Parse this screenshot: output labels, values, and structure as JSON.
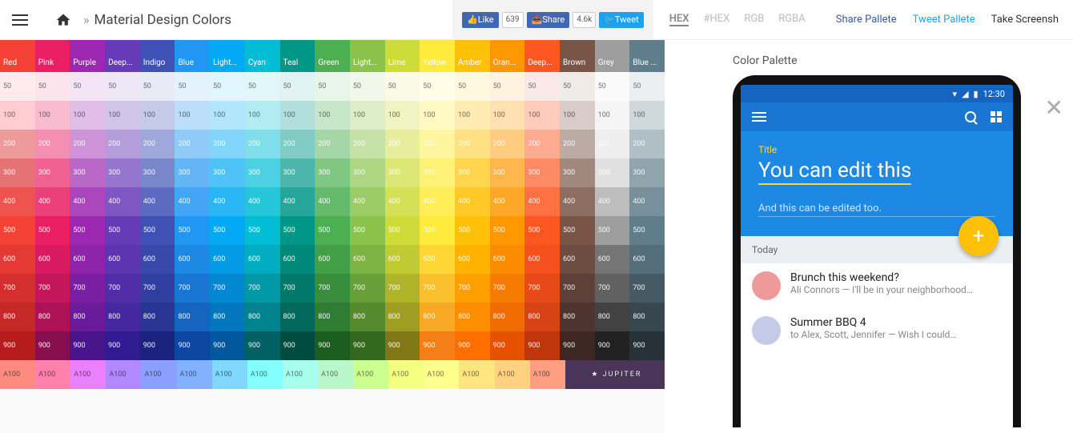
{
  "header": {
    "title": "Material Design Colors",
    "sep": "»"
  },
  "social": {
    "like": "Like",
    "like_cnt": "639",
    "share": "Share",
    "share_cnt": "4.6k",
    "tweet": "Tweet"
  },
  "formats": [
    "HEX",
    "#HEX",
    "RGB",
    "RGBA"
  ],
  "actions": {
    "share": "Share Pallete",
    "tweet": "Tweet Pallete",
    "screenshot": "Take Screensh"
  },
  "side": {
    "title": "Color Palette"
  },
  "phone": {
    "time": "12:30",
    "hero_label": "Title",
    "hero_title": "You can edit this",
    "hero_sub": "And this can be edited too.",
    "section": "Today",
    "items": [
      {
        "title": "Brunch this weekend?",
        "sub": "Ali Connors — I'll be in your neighborhood…"
      },
      {
        "title": "Summer BBQ  4",
        "sub": "to Alex, Scott, Jennifer — Wish I could…"
      }
    ]
  },
  "colors": {
    "names": [
      "Red",
      "Pink",
      "Purple",
      "Deep...",
      "Indigo",
      "Blue",
      "Light...",
      "Cyan",
      "Teal",
      "Green",
      "Light...",
      "Lime",
      "Yellow",
      "Amber",
      "Oran...",
      "Deep...",
      "Brown",
      "Grey",
      "Blue ..."
    ],
    "shades": [
      "50",
      "100",
      "200",
      "300",
      "400",
      "500",
      "600",
      "700",
      "800",
      "900",
      "A100"
    ],
    "hdr": [
      "#F44336",
      "#E91E63",
      "#9C27B0",
      "#673AB7",
      "#3F51B5",
      "#2196F3",
      "#03A9F4",
      "#00BCD4",
      "#009688",
      "#4CAF50",
      "#8BC34A",
      "#CDDC39",
      "#FFEB3B",
      "#FFC107",
      "#FF9800",
      "#FF5722",
      "#795548",
      "#9E9E9E",
      "#607D8B"
    ],
    "rows": [
      [
        "#FFEBEE",
        "#FCE4EC",
        "#F3E5F5",
        "#EDE7F6",
        "#E8EAF6",
        "#E3F2FD",
        "#E1F5FE",
        "#E0F7FA",
        "#E0F2F1",
        "#E8F5E9",
        "#F1F8E9",
        "#F9FBE7",
        "#FFFDE7",
        "#FFF8E1",
        "#FFF3E0",
        "#FBE9E7",
        "#EFEBE9",
        "#FAFAFA",
        "#ECEFF1"
      ],
      [
        "#FFCDD2",
        "#F8BBD0",
        "#E1BEE7",
        "#D1C4E9",
        "#C5CAE9",
        "#BBDEFB",
        "#B3E5FC",
        "#B2EBF2",
        "#B2DFDB",
        "#C8E6C9",
        "#DCEDC8",
        "#F0F4C3",
        "#FFF9C4",
        "#FFECB3",
        "#FFE0B2",
        "#FFCCBC",
        "#D7CCC8",
        "#F5F5F5",
        "#CFD8DC"
      ],
      [
        "#EF9A9A",
        "#F48FB1",
        "#CE93D8",
        "#B39DDB",
        "#9FA8DA",
        "#90CAF9",
        "#81D4FA",
        "#80DEEA",
        "#80CBC4",
        "#A5D6A7",
        "#C5E1A5",
        "#E6EE9C",
        "#FFF59D",
        "#FFE082",
        "#FFCC80",
        "#FFAB91",
        "#BCAAA4",
        "#EEEEEE",
        "#B0BEC5"
      ],
      [
        "#E57373",
        "#F06292",
        "#BA68C8",
        "#9575CD",
        "#7986CB",
        "#64B5F6",
        "#4FC3F7",
        "#4DD0E1",
        "#4DB6AC",
        "#81C784",
        "#AED581",
        "#DCE775",
        "#FFF176",
        "#FFD54F",
        "#FFB74D",
        "#FF8A65",
        "#A1887F",
        "#E0E0E0",
        "#90A4AE"
      ],
      [
        "#EF5350",
        "#EC407A",
        "#AB47BC",
        "#7E57C2",
        "#5C6BC0",
        "#42A5F5",
        "#29B6F6",
        "#26C6DA",
        "#26A69A",
        "#66BB6A",
        "#9CCC65",
        "#D4E157",
        "#FFEE58",
        "#FFCA28",
        "#FFA726",
        "#FF7043",
        "#8D6E63",
        "#BDBDBD",
        "#78909C"
      ],
      [
        "#F44336",
        "#E91E63",
        "#9C27B0",
        "#673AB7",
        "#3F51B5",
        "#2196F3",
        "#03A9F4",
        "#00BCD4",
        "#009688",
        "#4CAF50",
        "#8BC34A",
        "#CDDC39",
        "#FFEB3B",
        "#FFC107",
        "#FF9800",
        "#FF5722",
        "#795548",
        "#9E9E9E",
        "#607D8B"
      ],
      [
        "#E53935",
        "#D81B60",
        "#8E24AA",
        "#5E35B1",
        "#3949AB",
        "#1E88E5",
        "#039BE5",
        "#00ACC1",
        "#00897B",
        "#43A047",
        "#7CB342",
        "#C0CA33",
        "#FDD835",
        "#FFB300",
        "#FB8C00",
        "#F4511E",
        "#6D4C41",
        "#757575",
        "#546E7A"
      ],
      [
        "#D32F2F",
        "#C2185B",
        "#7B1FA2",
        "#512DA8",
        "#303F9F",
        "#1976D2",
        "#0288D1",
        "#0097A7",
        "#00796B",
        "#388E3C",
        "#689F38",
        "#AFB42B",
        "#FBC02D",
        "#FFA000",
        "#F57C00",
        "#E64A19",
        "#5D4037",
        "#616161",
        "#455A64"
      ],
      [
        "#C62828",
        "#AD1457",
        "#6A1B9A",
        "#4527A0",
        "#283593",
        "#1565C0",
        "#0277BD",
        "#00838F",
        "#00695C",
        "#2E7D32",
        "#558B2F",
        "#9E9D24",
        "#F9A825",
        "#FF8F00",
        "#EF6C00",
        "#D84315",
        "#4E342E",
        "#424242",
        "#37474F"
      ],
      [
        "#B71C1C",
        "#880E4F",
        "#4A148C",
        "#311B92",
        "#1A237E",
        "#0D47A1",
        "#01579B",
        "#006064",
        "#004D40",
        "#1B5E20",
        "#33691E",
        "#827717",
        "#F57F17",
        "#FF6F00",
        "#E65100",
        "#BF360C",
        "#3E2723",
        "#212121",
        "#263238"
      ],
      [
        "#FF8A80",
        "#FF80AB",
        "#EA80FC",
        "#B388FF",
        "#8C9EFF",
        "#82B1FF",
        "#80D8FF",
        "#84FFFF",
        "#A7FFEB",
        "#B9F6CA",
        "#CCFF90",
        "#F4FF81",
        "#FFFF8D",
        "#FFE57F",
        "#FFD180",
        "#FF9E80",
        "",
        "",
        ""
      ]
    ]
  },
  "jupiter": "JUPITER"
}
